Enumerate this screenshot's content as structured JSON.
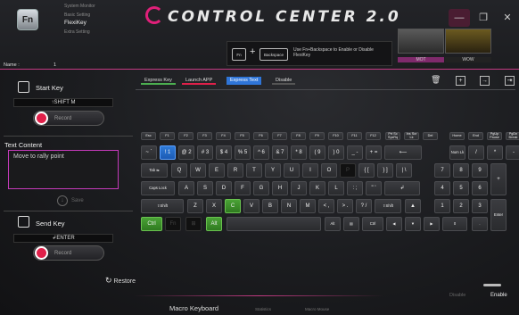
{
  "header": {
    "logo_text": "CONTROL CENTER 2.0",
    "fn_icon": "Fn",
    "menu": [
      "System Monitor",
      "Basic Setting",
      "FlexiKey",
      "Extra Setting"
    ],
    "name_label": "Name :",
    "name_value": "1",
    "hint_key1": "Fn",
    "hint_key2": "Backspace",
    "hint_text": "Use Fn+Backspace to Enable or Disable FlexiKey",
    "profiles": [
      {
        "label": "MOT"
      },
      {
        "label": "WOW"
      }
    ]
  },
  "start_key": {
    "title": "Start Key",
    "value": "↑SHIFT M",
    "record_label": "Record"
  },
  "text_content": {
    "title": "Text Content",
    "value": "Move to rally point",
    "save_label": "Save"
  },
  "send_key": {
    "title": "Send Key",
    "value": "↲ENTER",
    "record_label": "Record"
  },
  "restore_label": "Restore",
  "tabs": [
    {
      "label": "Express Key",
      "color": "#4caf50"
    },
    {
      "label": "Launch APP",
      "color": "#e0204a"
    },
    {
      "label": "Express Text",
      "color": "#2f75d8"
    },
    {
      "label": "Disable",
      "color": "#555555"
    }
  ],
  "toggle": {
    "disable_label": "Disable",
    "enable_label": "Enable"
  },
  "footer": {
    "macro_keyboard": "Macro Keyboard",
    "statistics": "Statistics",
    "macro_mouse": "Macro Mouse"
  },
  "keys": {
    "fn_row": [
      "Esc",
      "F1",
      "F2",
      "F3",
      "F4",
      "F5",
      "F6",
      "F7",
      "F8",
      "F9",
      "F10",
      "F11",
      "F12",
      "Prt Sc SysRq",
      "Ins Scr Lk",
      "Del",
      "Home",
      "End",
      "PgUp Pause",
      "PgDn Break"
    ],
    "num_row": [
      "~ `",
      "! 1",
      "@ 2",
      "# 3",
      "$ 4",
      "% 5",
      "^ 6",
      "& 7",
      "* 8",
      "( 9",
      ") 0",
      "_ -",
      "+ =",
      "⟵",
      "Num Lk",
      "/",
      "*",
      "-"
    ],
    "tab_row": [
      "Tab ⇆",
      "Q",
      "W",
      "E",
      "R",
      "T",
      "Y",
      "U",
      "I",
      "O",
      "P",
      "{ [",
      "} ]",
      "| \\",
      "7",
      "8",
      "9",
      "+"
    ],
    "caps_row": [
      "Caps Lock",
      "A",
      "S",
      "D",
      "F",
      "G",
      "H",
      "J",
      "K",
      "L",
      ": ;",
      "\" '",
      "↲",
      "4",
      "5",
      "6"
    ],
    "shift_row": [
      "⇧Shift",
      "Z",
      "X",
      "C",
      "V",
      "B",
      "N",
      "M",
      "< ,",
      "> .",
      "? /",
      "⇧Shift",
      "▲",
      "1",
      "2",
      "3",
      "Enter"
    ],
    "ctrl_row": [
      "Ctrl",
      "Fn",
      "⊞",
      "Alt",
      "",
      "Alt",
      "▤",
      "Ctrl",
      "◀",
      "▼",
      "▶",
      "0",
      "."
    ]
  },
  "colors": {
    "accent": "#c23a82",
    "selected": "#2f75d8",
    "green": "#4aa236"
  }
}
